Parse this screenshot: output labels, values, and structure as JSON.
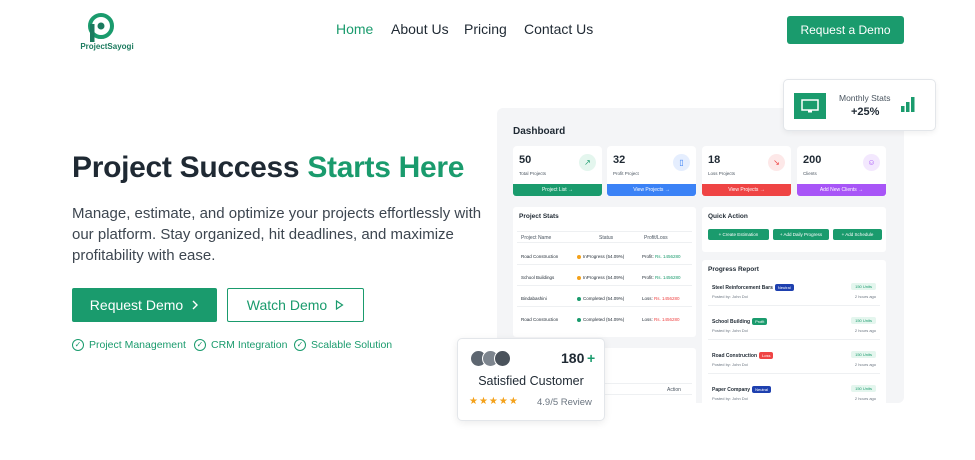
{
  "brand": {
    "name": "ProjectSayogi",
    "color": "#1a9b6d"
  },
  "nav": {
    "links": [
      {
        "label": "Home",
        "active": true
      },
      {
        "label": "About Us",
        "active": false
      },
      {
        "label": "Pricing",
        "active": false
      },
      {
        "label": "Contact Us",
        "active": false
      }
    ],
    "cta_label": "Request a Demo"
  },
  "hero": {
    "title_main": "Project Success ",
    "title_highlight": "Starts Here",
    "subtitle": "Manage, estimate, and optimize your projects effortlessly with our platform. Stay organized, hit deadlines, and maximize profitability with ease.",
    "primary_label": "Request Demo",
    "secondary_label": "Watch Demo",
    "features": [
      "Project Management",
      "CRM Integration",
      "Scalable Solution"
    ]
  },
  "monthly_stats": {
    "label": "Monthly Stats",
    "value": "+25%",
    "icon": "monitor-icon"
  },
  "satisfied": {
    "count": "180",
    "plus": "+",
    "label": "Satisfied Customer",
    "stars": "★★★★★",
    "review": "4.9/5 Review"
  },
  "dashboard": {
    "title": "Dashboard",
    "cards": [
      {
        "num": "50",
        "label": "Total Projects",
        "button": "Project List →",
        "color": "#1a9b6d",
        "icon": "chart-line-icon",
        "icon_bg": "#e4f6ee"
      },
      {
        "num": "32",
        "label": "Profit Project",
        "button": "View Projects →",
        "color": "#3b82f6",
        "icon": "book-icon",
        "icon_bg": "#e5eefe"
      },
      {
        "num": "18",
        "label": "Loss Projects",
        "button": "View Projects →",
        "color": "#ef4444",
        "icon": "chart-down-icon",
        "icon_bg": "#fde8e8"
      },
      {
        "num": "200",
        "label": "Clients",
        "button": "Add New Clients →",
        "color": "#a855f7",
        "icon": "users-icon",
        "icon_bg": "#f3e8fe"
      }
    ],
    "stats": {
      "title": "Project Stats",
      "headers": [
        "Project Name",
        "Status",
        "Profit/Loss"
      ],
      "rows": [
        {
          "name": "Road Construction",
          "status": "InProgress (54.09%)",
          "status_color": "#f4a11a",
          "pl_label": "Profit:",
          "pl_value": "Rs. 1456280",
          "pl_color": "#1a9b6d"
        },
        {
          "name": "School Buildings",
          "status": "InProgress (54.09%)",
          "status_color": "#f4a11a",
          "pl_label": "Profit:",
          "pl_value": "Rs. 1456280",
          "pl_color": "#1a9b6d"
        },
        {
          "name": "Bindabashini",
          "status": "Completed (54.09%)",
          "status_color": "#1a9b6d",
          "pl_label": "Loss:",
          "pl_value": "Rs. 1456280",
          "pl_color": "#ef4444"
        },
        {
          "name": "Road Construction",
          "status": "Completed (54.09%)",
          "status_color": "#1a9b6d",
          "pl_label": "Loss:",
          "pl_value": "Rs. 1456280",
          "pl_color": "#ef4444"
        }
      ],
      "second_header": "Action"
    },
    "quick_action": {
      "title": "Quick Action",
      "buttons": [
        "+ Create Estimation",
        "+ Add Daily Progress",
        "+ Add Schedule"
      ]
    },
    "progress": {
      "title": "Progress Report",
      "rows": [
        {
          "name": "Steel Reinforcement Bars",
          "tag": "Neutral",
          "tag_color": "#1e40af",
          "by": "Posted by: John Doi",
          "units": "150 Units",
          "ago": "2 hours ago"
        },
        {
          "name": "School Building",
          "tag": "Profit",
          "tag_color": "#1a9b6d",
          "by": "Posted by: John Doi",
          "units": "150 Units",
          "ago": "2 hours ago"
        },
        {
          "name": "Road Construction",
          "tag": "Loss",
          "tag_color": "#ef4444",
          "by": "Posted by: John Doi",
          "units": "150 Units",
          "ago": "2 hours ago"
        },
        {
          "name": "Paper Company",
          "tag": "Neutral",
          "tag_color": "#1e40af",
          "by": "Posted by: John Doi",
          "units": "150 Units",
          "ago": "2 hours ago"
        }
      ]
    }
  }
}
